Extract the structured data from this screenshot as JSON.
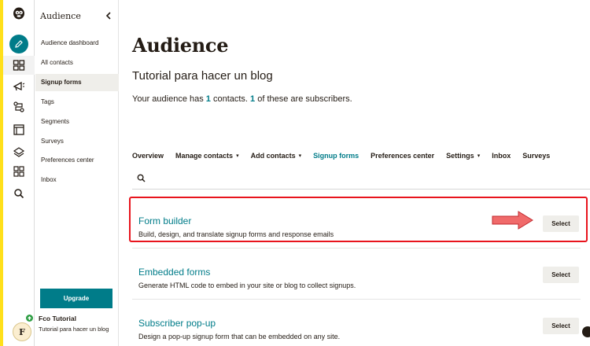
{
  "sidebar": {
    "title": "Audience",
    "items": [
      {
        "label": "Audience dashboard"
      },
      {
        "label": "All contacts"
      },
      {
        "label": "Signup forms"
      },
      {
        "label": "Tags"
      },
      {
        "label": "Segments"
      },
      {
        "label": "Surveys"
      },
      {
        "label": "Preferences center"
      },
      {
        "label": "Inbox"
      }
    ],
    "upgrade_label": "Upgrade",
    "account_name": "Fco Tutorial",
    "account_sub": "Tutorial para hacer un blog"
  },
  "rail": {
    "avatar_initial": "F",
    "icons": [
      "mailchimp-logo-icon",
      "create-pencil-icon",
      "audience-icon",
      "campaigns-icon",
      "automations-icon",
      "website-icon",
      "integrations-icon",
      "grid-icon",
      "search-icon"
    ]
  },
  "main": {
    "title": "Audience",
    "audience_name": "Tutorial para hacer un blog",
    "summary_prefix": "Your audience has ",
    "contacts_count": "1",
    "summary_middle": " contacts. ",
    "subscribers_count": "1",
    "summary_suffix": " of these are subscribers.",
    "tabs": [
      {
        "label": "Overview",
        "has_caret": false
      },
      {
        "label": "Manage contacts",
        "has_caret": true
      },
      {
        "label": "Add contacts",
        "has_caret": true
      },
      {
        "label": "Signup forms",
        "has_caret": false
      },
      {
        "label": "Preferences center",
        "has_caret": false
      },
      {
        "label": "Settings",
        "has_caret": true
      },
      {
        "label": "Inbox",
        "has_caret": false
      },
      {
        "label": "Surveys",
        "has_caret": false
      }
    ],
    "caret_glyph": "▾",
    "forms": [
      {
        "title": "Form builder",
        "desc": "Build, design, and translate signup forms and response emails",
        "button": "Select"
      },
      {
        "title": "Embedded forms",
        "desc": "Generate HTML code to embed in your site or blog to collect signups.",
        "button": "Select"
      },
      {
        "title": "Subscriber pop-up",
        "desc": "Design a pop-up signup form that can be embedded on any site.",
        "button": "Select"
      }
    ]
  },
  "colors": {
    "accent": "#007c89",
    "brand_yellow": "#ffe01b",
    "highlight_red": "#e8141d",
    "arrow_fill": "#f06a6a"
  }
}
